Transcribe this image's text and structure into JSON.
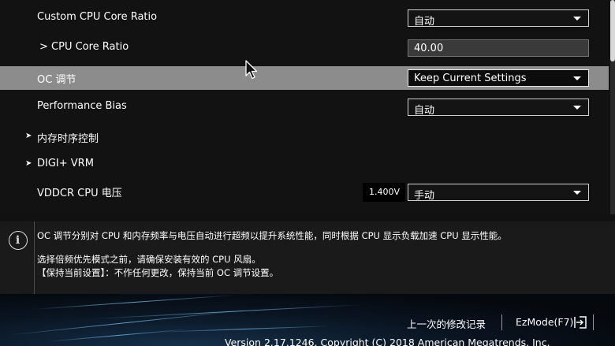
{
  "settings": {
    "custom_cpu_core_ratio": {
      "label": "Custom CPU Core Ratio",
      "value": "自动"
    },
    "cpu_core_ratio": {
      "label": "> CPU Core Ratio",
      "value": "40.00"
    },
    "oc_tuning": {
      "label": "OC 调节",
      "value": "Keep Current Settings"
    },
    "performance_bias": {
      "label": "Performance Bias",
      "value": "自动"
    },
    "memory_timing": {
      "label": "内存时序控制"
    },
    "digi_vrm": {
      "label": "DIGI+ VRM"
    },
    "vddcr_cpu_voltage": {
      "label": "VDDCR CPU 电压",
      "readout": "1.400V",
      "value": "手动"
    }
  },
  "info": {
    "icon": "info-icon",
    "line1": "OC 调节分别对 CPU 和内存频率与电压自动进行超频以提升系统性能，同时根据 CPU 显示负载加速 CPU 显示性能。",
    "line2": "选择倍频优先模式之前，请确保安装有效的 CPU 风扇。",
    "line3": "【保持当前设置】：不作任何更改，保持当前 OC 调节设置。"
  },
  "footer": {
    "last_modified": "上一次的修改记录",
    "ezmode": "EzMode(F7)",
    "version": "Version 2.17.1246. Copyright (C) 2018 American Megatrends, Inc."
  },
  "colors": {
    "highlight_row": "#8c8c8c",
    "background": "#121213",
    "info_panel": "#1a1a1b"
  }
}
